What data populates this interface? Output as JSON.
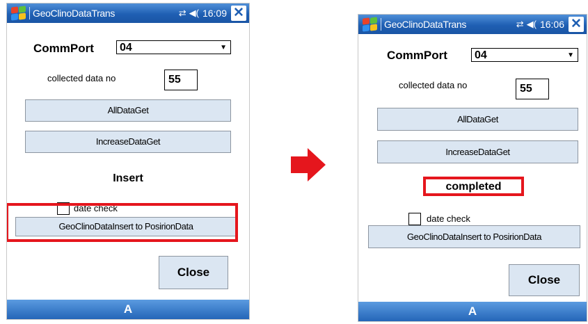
{
  "colors": {
    "highlight": "#e5161d",
    "button_bg": "#dbe6f2",
    "titlebar": "#1f5fb3"
  },
  "before": {
    "titlebar": {
      "app_title": "GeoClinoDataTrans",
      "time": "16:09",
      "close": "✕"
    },
    "commport_label": "CommPort",
    "commport_value": "04",
    "collected_label": "collected data no",
    "collected_value": "55",
    "all_data_get": "AllDataGet",
    "increase_data_get": "IncreaseDataGet",
    "status": "Insert",
    "date_check_label": "date check",
    "insert_button": "GeoClinoDataInsert to PosirionData",
    "close_button": "Close",
    "bottom_label": "A"
  },
  "after": {
    "titlebar": {
      "app_title": "GeoClinoDataTrans",
      "time": "16:06",
      "close": "✕"
    },
    "commport_label": "CommPort",
    "commport_value": "04",
    "collected_label": "collected data no",
    "collected_value": "55",
    "all_data_get": "AllDataGet",
    "increase_data_get": "IncreaseDataGet",
    "status": "completed",
    "date_check_label": "date check",
    "insert_button": "GeoClinoDataInsert to PosirionData",
    "close_button": "Close",
    "bottom_label": "A"
  }
}
